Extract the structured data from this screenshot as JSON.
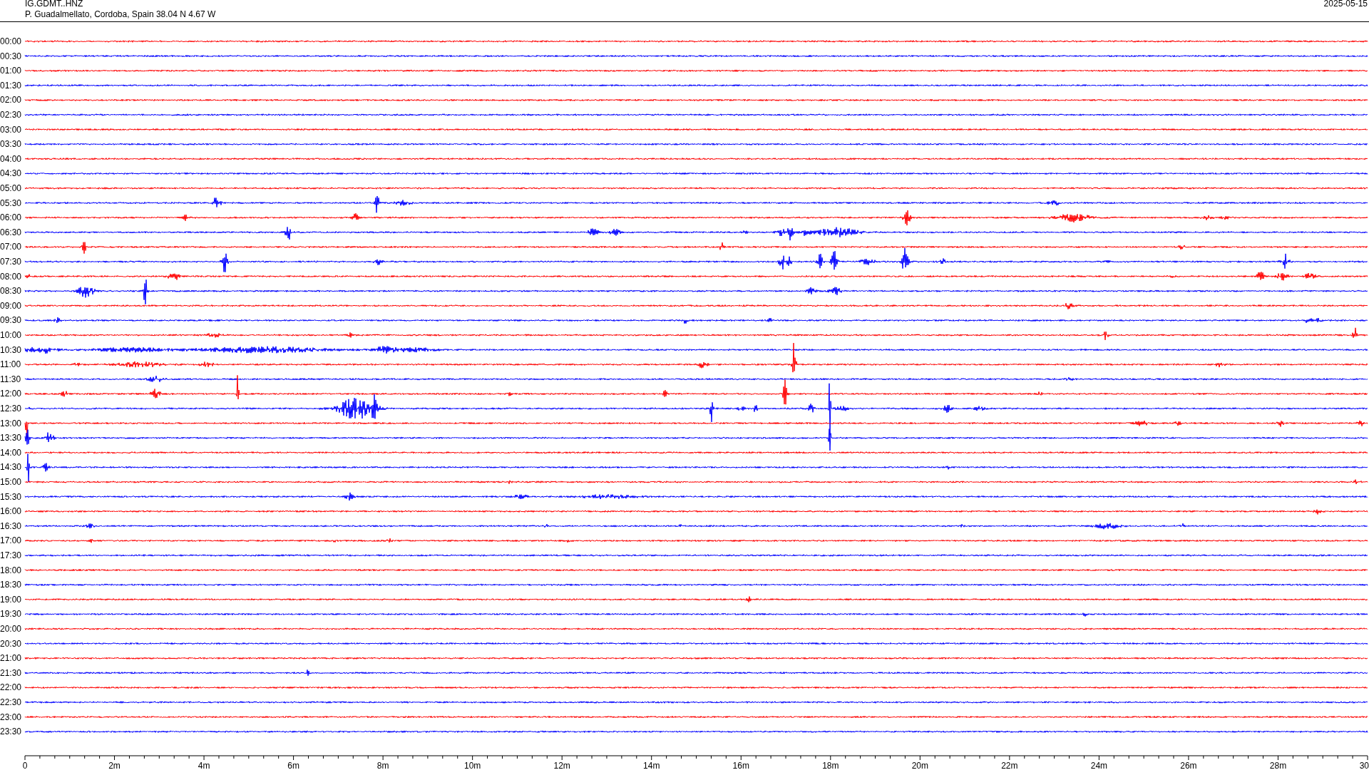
{
  "header": {
    "station": "IG.GDMT..HNZ",
    "location": "P. Guadalmellato, Cordoba, Spain  38.04 N 4.67 W",
    "date": "2025-05-15"
  },
  "rows": [
    {
      "label": "00:00",
      "color": "#ff0000"
    },
    {
      "label": "00:30",
      "color": "#0000ff"
    },
    {
      "label": "01:00",
      "color": "#ff0000"
    },
    {
      "label": "01:30",
      "color": "#0000ff"
    },
    {
      "label": "02:00",
      "color": "#ff0000"
    },
    {
      "label": "02:30",
      "color": "#0000ff"
    },
    {
      "label": "03:00",
      "color": "#ff0000"
    },
    {
      "label": "03:30",
      "color": "#0000ff"
    },
    {
      "label": "04:00",
      "color": "#ff0000"
    },
    {
      "label": "04:30",
      "color": "#0000ff"
    },
    {
      "label": "05:00",
      "color": "#ff0000"
    },
    {
      "label": "05:30",
      "color": "#0000ff"
    },
    {
      "label": "06:00",
      "color": "#ff0000"
    },
    {
      "label": "06:30",
      "color": "#0000ff"
    },
    {
      "label": "07:00",
      "color": "#ff0000"
    },
    {
      "label": "07:30",
      "color": "#0000ff"
    },
    {
      "label": "08:00",
      "color": "#ff0000"
    },
    {
      "label": "08:30",
      "color": "#0000ff"
    },
    {
      "label": "09:00",
      "color": "#ff0000"
    },
    {
      "label": "09:30",
      "color": "#0000ff"
    },
    {
      "label": "10:00",
      "color": "#ff0000"
    },
    {
      "label": "10:30",
      "color": "#0000ff"
    },
    {
      "label": "11:00",
      "color": "#ff0000"
    },
    {
      "label": "11:30",
      "color": "#0000ff"
    },
    {
      "label": "12:00",
      "color": "#ff0000"
    },
    {
      "label": "12:30",
      "color": "#0000ff"
    },
    {
      "label": "13:00",
      "color": "#ff0000"
    },
    {
      "label": "13:30",
      "color": "#0000ff"
    },
    {
      "label": "14:00",
      "color": "#ff0000"
    },
    {
      "label": "14:30",
      "color": "#0000ff"
    },
    {
      "label": "15:00",
      "color": "#ff0000"
    },
    {
      "label": "15:30",
      "color": "#0000ff"
    },
    {
      "label": "16:00",
      "color": "#ff0000"
    },
    {
      "label": "16:30",
      "color": "#0000ff"
    },
    {
      "label": "17:00",
      "color": "#ff0000"
    },
    {
      "label": "17:30",
      "color": "#0000ff"
    },
    {
      "label": "18:00",
      "color": "#ff0000"
    },
    {
      "label": "18:30",
      "color": "#0000ff"
    },
    {
      "label": "19:00",
      "color": "#ff0000"
    },
    {
      "label": "19:30",
      "color": "#0000ff"
    },
    {
      "label": "20:00",
      "color": "#ff0000"
    },
    {
      "label": "20:30",
      "color": "#0000ff"
    },
    {
      "label": "21:00",
      "color": "#ff0000"
    },
    {
      "label": "21:30",
      "color": "#0000ff"
    },
    {
      "label": "22:00",
      "color": "#ff0000"
    },
    {
      "label": "22:30",
      "color": "#0000ff"
    },
    {
      "label": "23:00",
      "color": "#ff0000"
    },
    {
      "label": "23:30",
      "color": "#0000ff"
    }
  ],
  "x_axis": {
    "ticks": [
      "0",
      "2m",
      "4m",
      "6m",
      "8m",
      "10m",
      "12m",
      "14m",
      "16m",
      "18m",
      "20m",
      "22m",
      "24m",
      "26m",
      "28m",
      "30"
    ]
  }
}
